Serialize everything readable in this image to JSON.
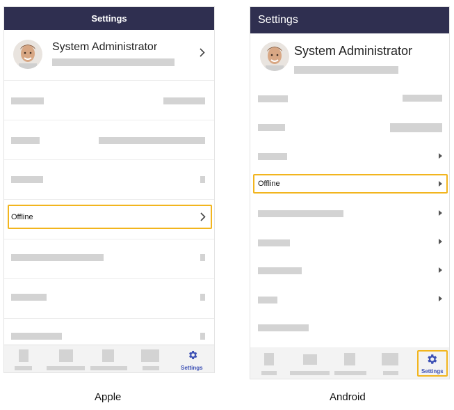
{
  "apple": {
    "header_title": "Settings",
    "profile_name": "System Administrator",
    "offline_label": "Offline",
    "tab_settings_label": "Settings",
    "caption": "Apple"
  },
  "android": {
    "header_title": "Settings",
    "profile_name": "System Administrator",
    "offline_label": "Offline",
    "tab_settings_label": "Settings",
    "caption": "Android"
  },
  "colors": {
    "header_bg": "#2f2f50",
    "highlight": "#f2b51e",
    "accent": "#3b4fb4",
    "placeholder": "#d3d3d3"
  },
  "icons": [
    "chevron-right-icon",
    "caret-right-icon",
    "gear-icon",
    "avatar"
  ]
}
